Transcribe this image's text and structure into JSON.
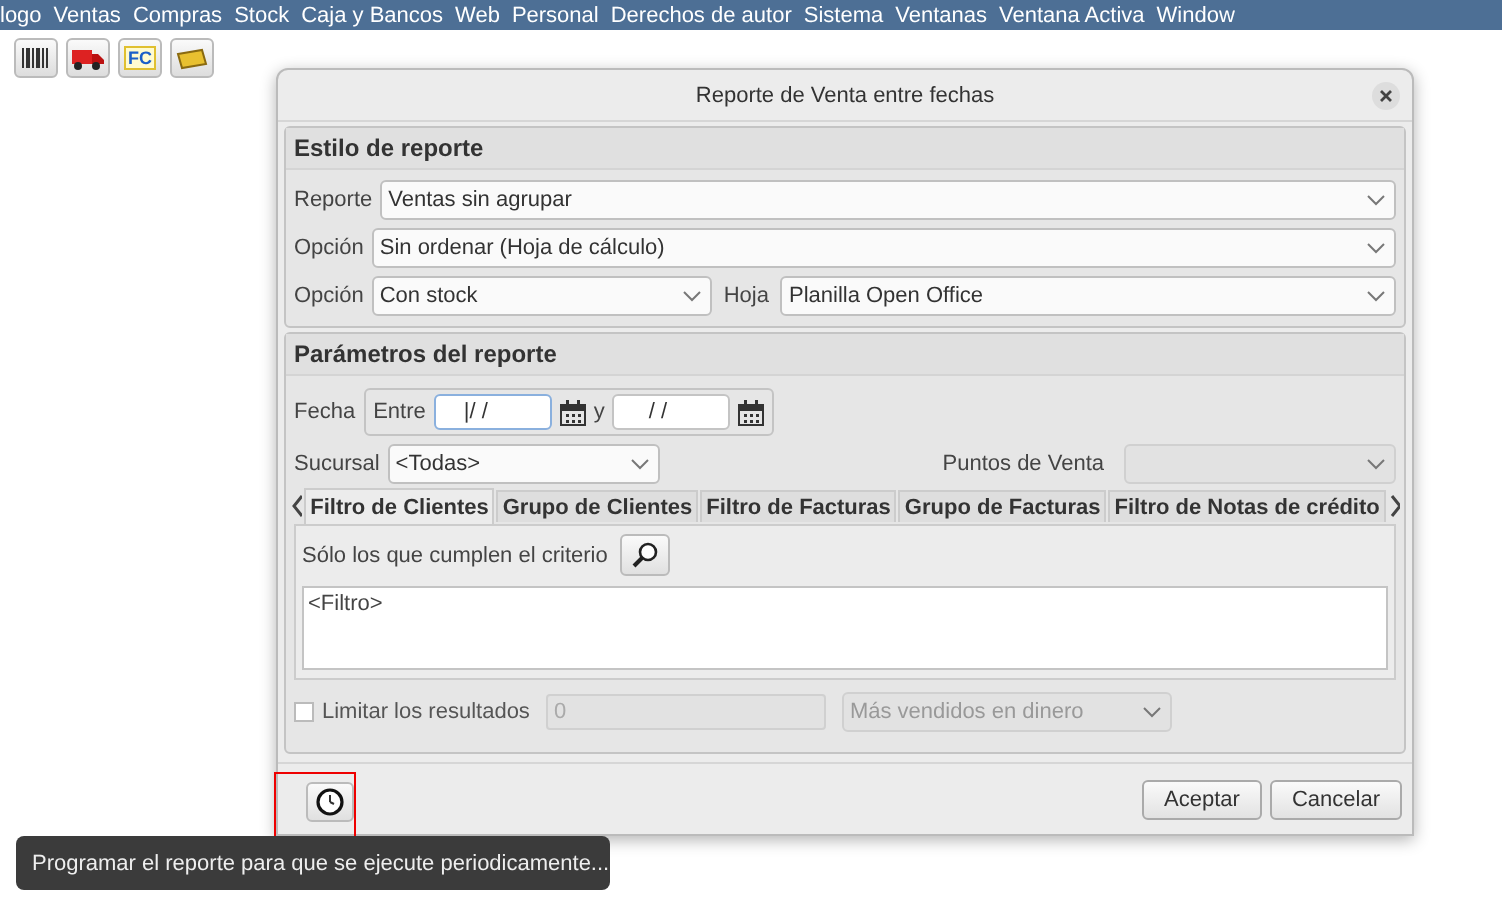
{
  "menu_bar": {
    "items": [
      "logo",
      "Ventas",
      "Compras",
      "Stock",
      "Caja y Bancos",
      "Web",
      "Personal",
      "Derechos de autor",
      "Sistema",
      "Ventanas",
      "Ventana Activa",
      "Window"
    ]
  },
  "toolbar": {
    "buttons": [
      {
        "kind": "barcode"
      },
      {
        "kind": "truck"
      },
      {
        "kind": "fc",
        "label": "FC"
      },
      {
        "kind": "ticket"
      }
    ]
  },
  "dialog": {
    "title": "Reporte de Venta entre fechas",
    "style_section": {
      "title": "Estilo de reporte",
      "report_label": "Reporte",
      "report_value": "Ventas sin agrupar",
      "option_label": "Opción",
      "option_value": "Sin ordenar (Hoja de cálculo)",
      "option2_label": "Opción",
      "option2_value": "Con stock",
      "sheet_label": "Hoja",
      "sheet_value": "Planilla Open Office"
    },
    "params_section": {
      "title": "Parámetros del reporte",
      "date_label": "Fecha",
      "between_label": "Entre",
      "from_value": "|/ /",
      "and_label": "y",
      "to_value": " / /",
      "branch_label": "Sucursal",
      "branch_value": "<Todas>",
      "pos_label": "Puntos de Venta",
      "tabs": [
        {
          "label": "Filtro de Clientes",
          "selected": true
        },
        {
          "label": "Grupo de Clientes",
          "selected": false
        },
        {
          "label": "Filtro de Facturas",
          "selected": false
        },
        {
          "label": "Grupo de Facturas",
          "selected": false
        },
        {
          "label": "Filtro de Notas de crédito",
          "selected": false
        }
      ],
      "criteria_label": "Sólo los que cumplen el criterio",
      "filter_text": "<Filtro>",
      "limit": {
        "label": "Limitar los resultados",
        "checked": false,
        "value": "0",
        "order_value": "Más vendidos en dinero",
        "disabled": true
      }
    },
    "buttons": [
      "Aceptar",
      "Cancelar"
    ]
  },
  "tooltip": "Programar el reporte para que se ejecute periodicamente..."
}
